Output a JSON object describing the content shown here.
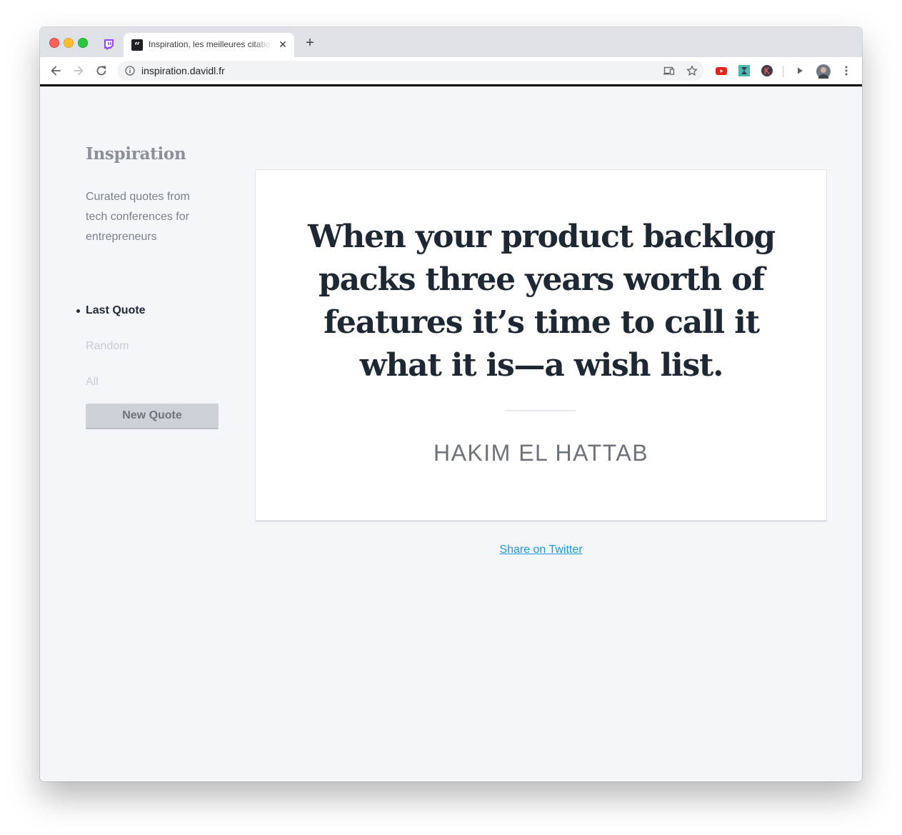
{
  "browser": {
    "tab_title": "Inspiration, les meilleures citations",
    "tab_favicon_glyph": "“",
    "close_glyph": "✕",
    "new_tab_glyph": "+",
    "url": "inspiration.davidl.fr",
    "icons": {
      "pinned_tab": "twitch-icon",
      "back": "arrow-left-icon",
      "forward": "arrow-right-icon",
      "reload": "reload-icon",
      "site_info": "info-icon",
      "cast": "cast-icon",
      "bookmark": "star-icon",
      "extensions": [
        "youtube-extension-icon",
        "puzzle-extension-icon",
        "k-extension-icon",
        "play-extension-icon"
      ],
      "profile": "avatar",
      "menu": "kebab-menu-icon"
    }
  },
  "sidebar": {
    "title": "Inspiration",
    "description": "Curated quotes from tech conferences for entrepreneurs",
    "nav": [
      {
        "label": "Last Quote",
        "active": true
      },
      {
        "label": "Random",
        "active": false
      },
      {
        "label": "All",
        "active": false
      }
    ],
    "new_quote_button": "New Quote"
  },
  "quote": {
    "text": "When your product backlog packs three years worth of features it’s time to call it what it is—a wish list.",
    "author": "HAKIM EL HATTAB"
  },
  "share": {
    "label": "Share on Twitter"
  },
  "colors": {
    "page_background": "#f5f6fa",
    "quote_text": "#1d2833",
    "link": "#1a9bd7",
    "muted": "#8a8f98"
  }
}
